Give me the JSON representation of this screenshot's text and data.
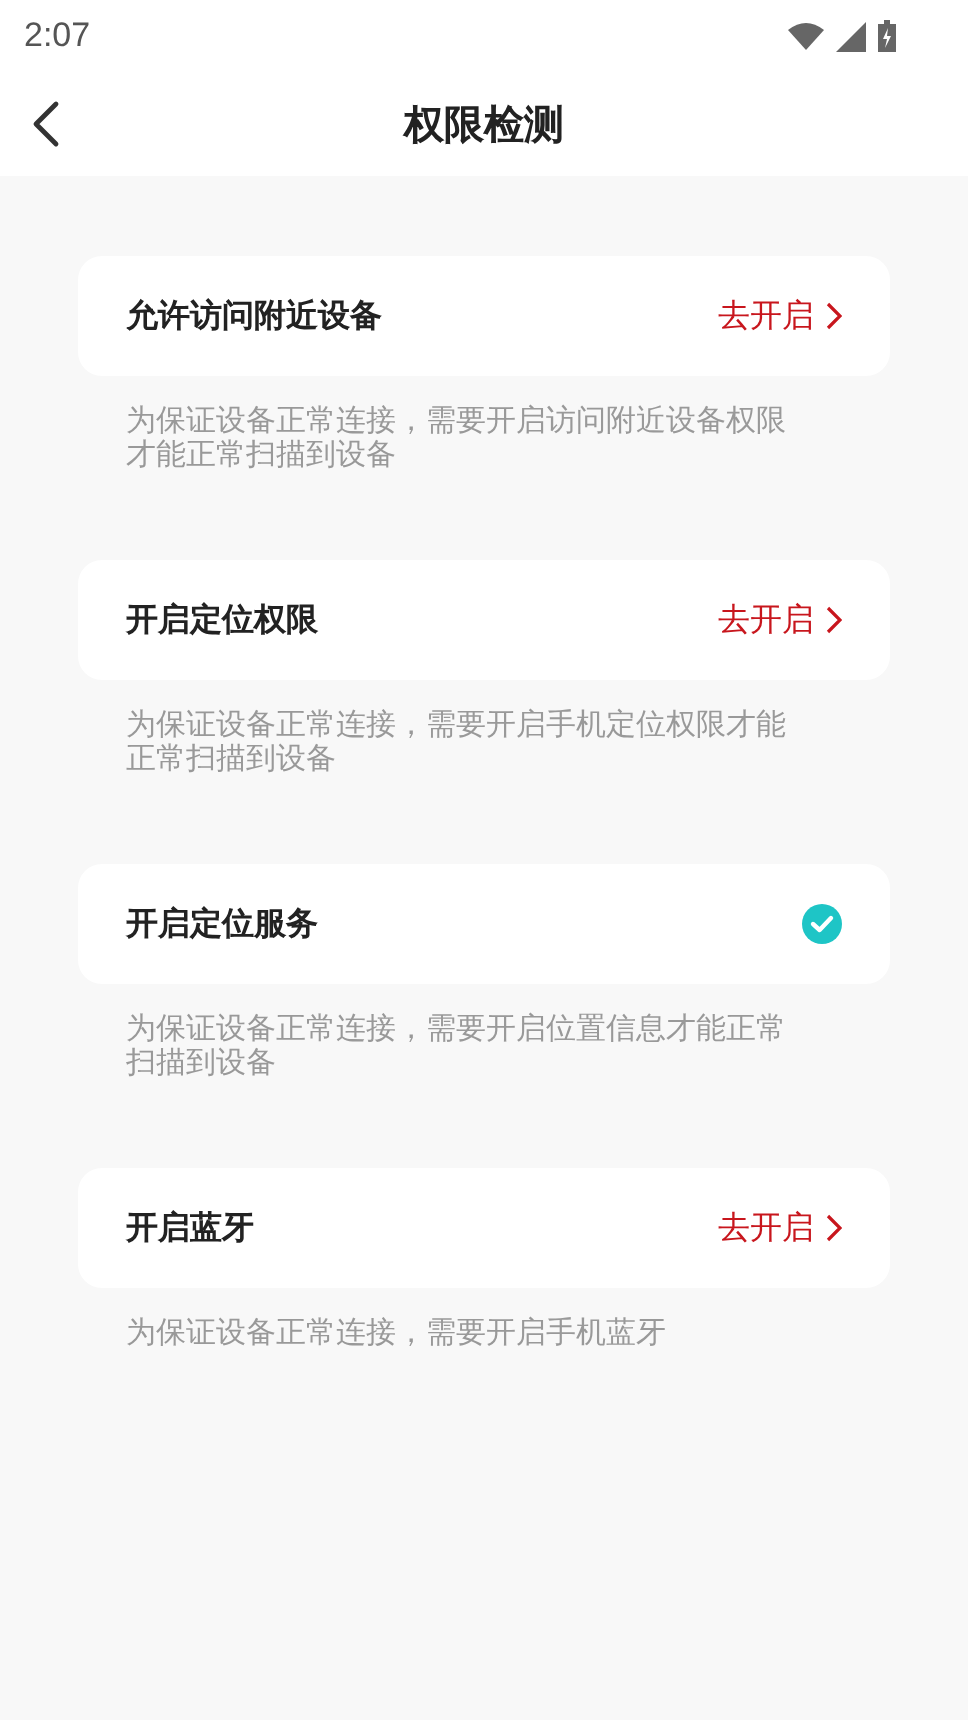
{
  "status_bar": {
    "time": "2:07"
  },
  "header": {
    "title": "权限检测"
  },
  "permissions": [
    {
      "title": "允许访问附近设备",
      "granted": false,
      "action": "去开启",
      "description": "为保证设备正常连接，需要开启访问附近设备权限才能正常扫描到设备"
    },
    {
      "title": "开启定位权限",
      "granted": false,
      "action": "去开启",
      "description": "为保证设备正常连接，需要开启手机定位权限才能正常扫描到设备"
    },
    {
      "title": "开启定位服务",
      "granted": true,
      "description": "为保证设备正常连接，需要开启位置信息才能正常扫描到设备"
    },
    {
      "title": "开启蓝牙",
      "granted": false,
      "action": "去开启",
      "description": "为保证设备正常连接，需要开启手机蓝牙"
    }
  ]
}
